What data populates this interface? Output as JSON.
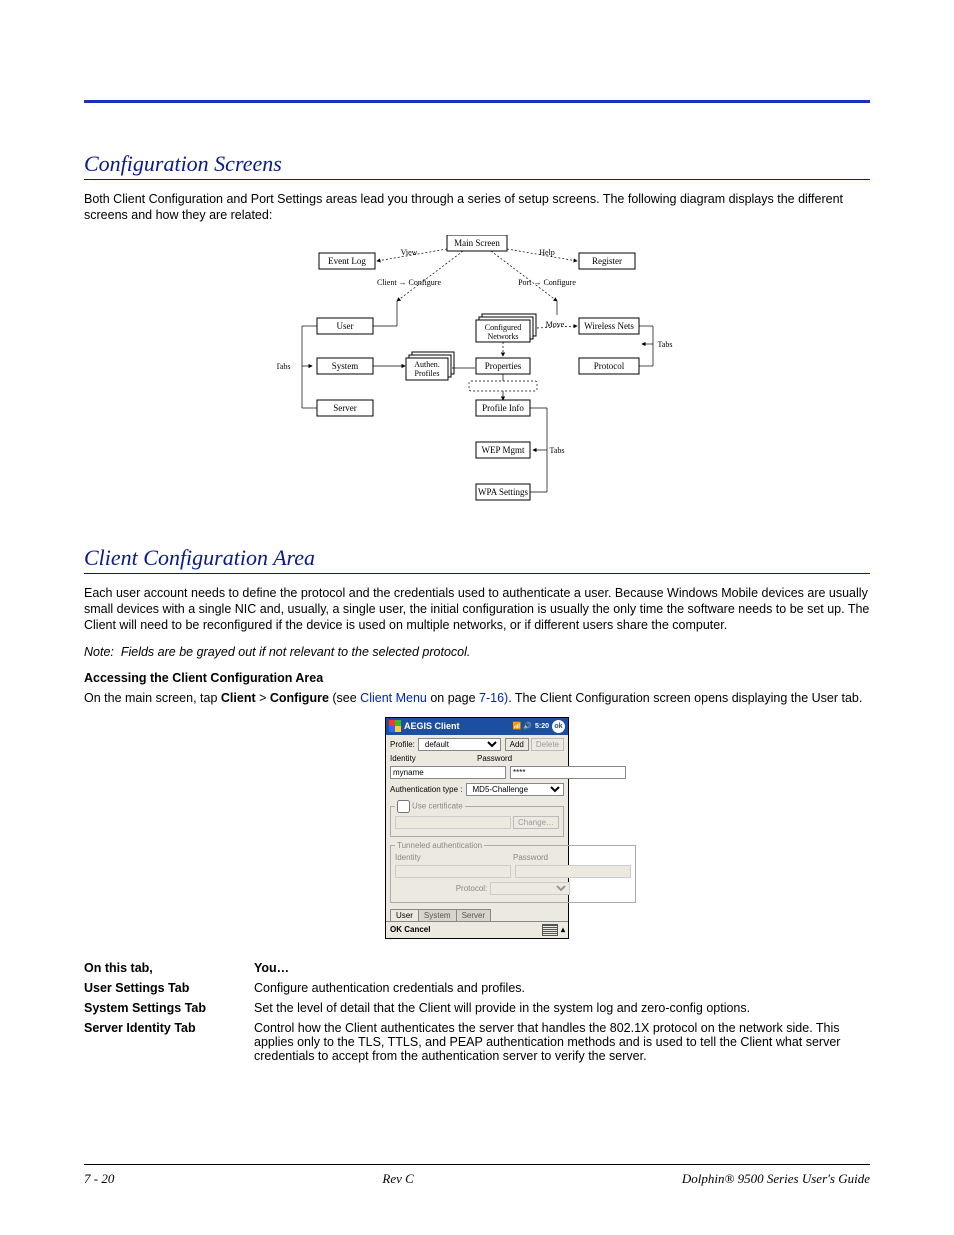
{
  "section1": {
    "title": "Configuration Screens",
    "para": "Both Client Configuration and Port Settings areas lead you through a series of setup screens. The following diagram displays the different screens and how they are related:"
  },
  "diagram": {
    "nodes": {
      "main_screen": "Main Screen",
      "event_log": "Event Log",
      "register": "Register",
      "view": "View",
      "help": "Help",
      "client_configure": "Client → Configure",
      "port_configure": "Port → Configure",
      "user": "User",
      "system": "System",
      "server": "Server",
      "authen_profiles1": "Authen.",
      "authen_profiles2": "Profiles",
      "configured_networks1": "Configured",
      "configured_networks2": "Networks",
      "wireless_nets": "Wireless Nets",
      "protocol": "Protocol",
      "properties": "Properties",
      "profile_info": "Profile Info",
      "wep_mgmt": "WEP Mgmt",
      "wpa_settings": "WPA Settings",
      "move": "Move",
      "tabs_left": "Tabs",
      "tabs_right": "Tabs",
      "tabs_mid": "Tabs"
    }
  },
  "section2": {
    "title": "Client Configuration Area",
    "para": "Each user account needs to define the protocol and the credentials used to authenticate a user. Because Windows Mobile devices are usually small devices with a single NIC and, usually, a single user, the initial configuration is usually the only time the software needs to be set up. The Client will need to be reconfigured if the device is used on multiple networks, or if different users share the computer.",
    "note_label": "Note:",
    "note_text": "Fields are be grayed out if not relevant to the selected protocol.",
    "access": {
      "heading": "Accessing the Client Configuration Area",
      "pre": "On the main screen, tap ",
      "client": "Client",
      "gt": " > ",
      "configure": "Configure",
      "see": " (see ",
      "link": "Client Menu",
      "onpage": " on page ",
      "pageref": "7-16)",
      "post": ". The Client Configuration screen opens displaying the User tab."
    }
  },
  "screenshot": {
    "title": "AEGIS Client",
    "time": "5:20",
    "ok": "ok",
    "profile_label": "Profile:",
    "profile_value": "default",
    "add": "Add",
    "delete": "Delete",
    "identity": "Identity",
    "password": "Password",
    "identity_value": "myname",
    "password_value": "****",
    "auth_type_label": "Authentication type :",
    "auth_type_value": "MD5-Challenge",
    "use_cert_legend": "Use certificate",
    "change": "Change…",
    "tunneled_legend": "Tunneled authentication",
    "protocol_label": "Protocol:",
    "tabs": {
      "user": "User",
      "system": "System",
      "server": "Server"
    },
    "ok_btn": "OK",
    "cancel_btn": "Cancel"
  },
  "table": {
    "head_left": "On this tab,",
    "head_right": "You…",
    "rows": [
      {
        "name": "User Settings Tab",
        "desc": "Configure authentication credentials and profiles."
      },
      {
        "name": "System Settings Tab",
        "desc": "Set the level of detail that the Client will provide in the system log and zero-config options."
      },
      {
        "name": "Server Identity Tab",
        "desc": "Control how the Client authenticates the server that handles the 802.1X protocol on the network side. This applies only to the TLS, TTLS, and PEAP authentication methods and is used to tell the Client what server credentials to accept from the authentication server to verify the server."
      }
    ]
  },
  "footer": {
    "left": "7 - 20",
    "center": "Rev C",
    "right": "Dolphin® 9500 Series User's Guide"
  }
}
